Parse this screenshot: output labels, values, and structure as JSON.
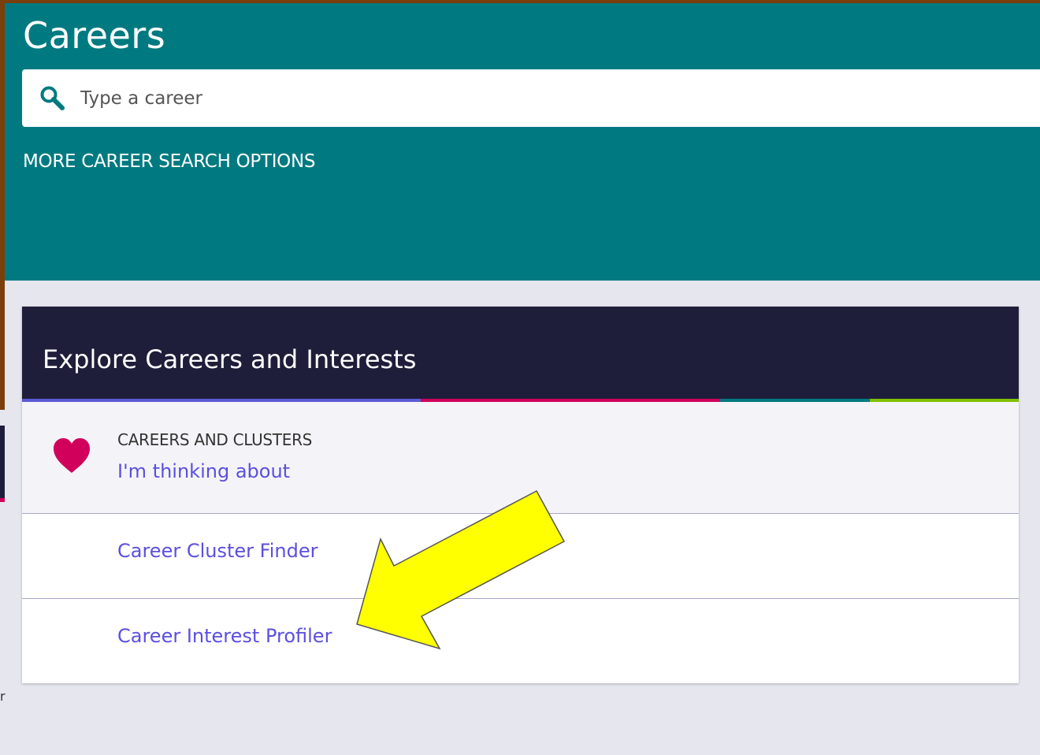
{
  "header": {
    "title": "Careers",
    "search_placeholder": "Type a career",
    "more_options_label": "MORE CAREER SEARCH OPTIONS"
  },
  "card": {
    "title": "Explore Careers and Interests",
    "rows": [
      {
        "subtitle": "CAREERS AND CLUSTERS",
        "link": "I'm thinking about",
        "icon": "heart-icon"
      },
      {
        "link": "Career Cluster Finder"
      },
      {
        "link": "Career Interest Profiler"
      }
    ]
  },
  "edge_text": "r",
  "colors": {
    "header_bg": "#007a80",
    "card_head_bg": "#1e1e3a",
    "link": "#5b4fe0",
    "heart": "#d0005b",
    "accent_purple": "#5b5bd8",
    "accent_pink": "#d0005b",
    "accent_teal": "#007a80",
    "accent_green": "#7fc000",
    "annotation_arrow": "#ffff00"
  }
}
